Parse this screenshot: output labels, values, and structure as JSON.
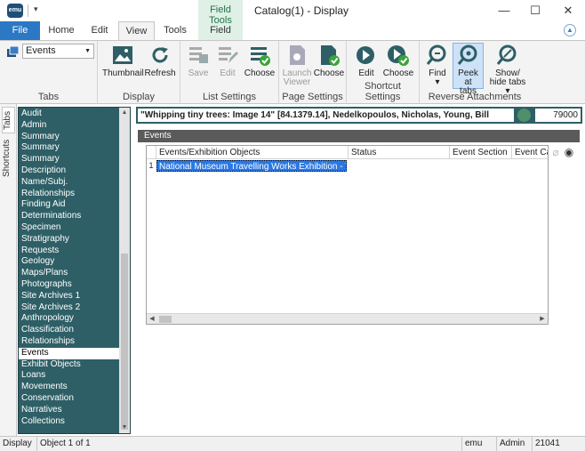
{
  "window": {
    "app_icon": "emu",
    "title": "Catalog(1) - Display",
    "contextual_tab_group": "Field Tools",
    "minimize": "—",
    "maximize": "☐",
    "close": "✕"
  },
  "tabs": [
    "File",
    "Home",
    "Edit",
    "View",
    "Tools",
    "Field"
  ],
  "active_tab": "View",
  "ribbon": {
    "tabs_group": {
      "label": "Tabs",
      "select_value": "Events"
    },
    "display_group": {
      "label": "Display",
      "thumbnail": "Thumbnail",
      "refresh": "Refresh"
    },
    "list_settings_group": {
      "label": "List Settings",
      "save": "Save",
      "edit": "Edit",
      "choose": "Choose"
    },
    "page_settings_group": {
      "label": "Page Settings",
      "launch_viewer_1": "Launch",
      "launch_viewer_2": "Viewer",
      "choose": "Choose"
    },
    "shortcut_settings_group": {
      "label": "Shortcut Settings",
      "edit": "Edit",
      "choose": "Choose"
    },
    "reverse_attachments_group": {
      "label": "Reverse Attachments",
      "find": "Find",
      "peek_1": "Peek at",
      "peek_2": "tabs",
      "show_hide_1": "Show/",
      "show_hide_2": "hide tabs"
    }
  },
  "vertical_tabs": [
    "Tabs",
    "Shortcuts"
  ],
  "sidebar": {
    "items": [
      "Audit",
      "Admin",
      "Summary",
      "Summary",
      "Summary",
      "Description",
      "Name/Subj.",
      "Relationships",
      "Finding Aid",
      "Determinations",
      "Specimen",
      "Stratigraphy",
      "Requests",
      "Geology",
      "Maps/Plans",
      "Photographs",
      "Site Archives 1",
      "Site Archives 2",
      "Anthropology",
      "Classification",
      "Relationships",
      "Events",
      "Exhibit Objects",
      "Loans",
      "Movements",
      "Conservation",
      "Narratives",
      "Collections"
    ],
    "selected": "Events"
  },
  "record": {
    "title": "\"Whipping tiny trees: Image 14\" [84.1379.14], Nedelkopoulos, Nicholas, Young, Bill",
    "number": "79000"
  },
  "events_section": {
    "header": "Events",
    "columns": [
      "Events/Exhibition Objects",
      "Status",
      "Event Section",
      "Event Cata"
    ],
    "rows": [
      {
        "num": "1",
        "event": "National Museum Travelling Works Exhibition - Travel...",
        "status": "",
        "section": "",
        "cata": ""
      }
    ]
  },
  "statusbar": {
    "mode": "Display",
    "position": "Object 1 of 1",
    "db": "emu",
    "user": "Admin",
    "count": "21041"
  },
  "colors": {
    "file_tab": "#2b78c5",
    "sidebar_bg": "#2e5f66",
    "field_tools": "#217346",
    "selection": "#2b78e4"
  }
}
